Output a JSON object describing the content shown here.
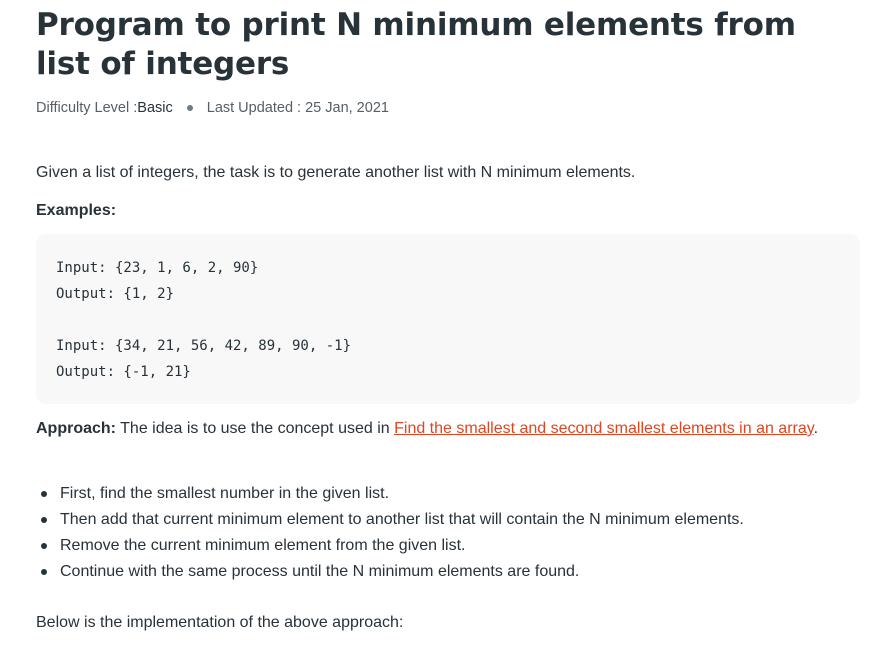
{
  "article": {
    "title": "Program to print N minimum elements from list of integers",
    "meta": {
      "difficulty_prefix": "Difficulty Level : ",
      "difficulty_value": "Basic",
      "updated": "Last Updated : 25 Jan, 2021"
    },
    "intro": "Given a list of integers, the task is to generate another list with N minimum elements.",
    "examples_heading": "Examples:",
    "code_lines": [
      "Input: {23, 1, 6, 2, 90}",
      "Output: {1, 2}",
      "",
      "Input: {34, 21, 56, 42, 89, 90, -1}",
      "Output: {-1, 21}"
    ],
    "approach": {
      "label": "Approach:",
      "text": " The idea is to use the concept used in ",
      "link_text": "Find the smallest and second smallest elements in an array",
      "end": "."
    },
    "steps": [
      "First, find the smallest number in the given list.",
      "Then add that current minimum element to another list that will contain the N minimum elements.",
      "Remove the current minimum element from the given list.",
      "Continue with the same process until the N minimum elements are found."
    ],
    "below": "Below is the implementation of the above approach:"
  },
  "colors": {
    "text": "#273239",
    "meta": "#555f66",
    "link": "#e0451f",
    "code_background": "#f8f8f8"
  }
}
